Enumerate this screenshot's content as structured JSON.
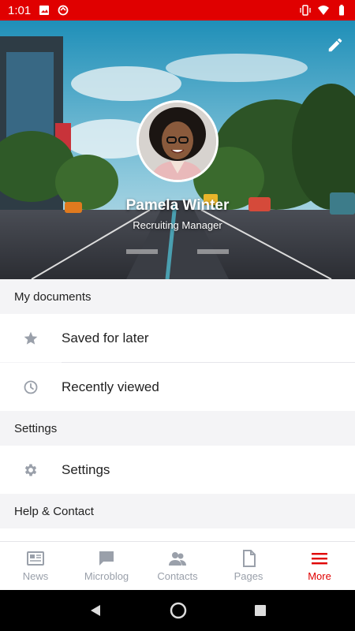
{
  "status_bar": {
    "time": "1:01"
  },
  "profile": {
    "name": "Pamela Winter",
    "role": "Recruiting Manager"
  },
  "sections": {
    "documents_header": "My documents",
    "saved_label": "Saved for later",
    "recent_label": "Recently viewed",
    "settings_header": "Settings",
    "settings_label": "Settings",
    "help_header": "Help & Contact"
  },
  "nav": {
    "news": "News",
    "microblog": "Microblog",
    "contacts": "Contacts",
    "pages": "Pages",
    "more": "More"
  },
  "colors": {
    "accent": "#e00000",
    "inactive": "#9aa0aa"
  },
  "icons": [
    "image-icon",
    "sync-icon",
    "vibrate-icon",
    "wifi-icon",
    "battery-icon",
    "pencil-icon",
    "star-icon",
    "clock-icon",
    "gear-icon",
    "newspaper-icon",
    "chat-icon",
    "contacts-icon",
    "pages-icon",
    "menu-icon",
    "back-icon",
    "home-icon",
    "recents-icon"
  ]
}
